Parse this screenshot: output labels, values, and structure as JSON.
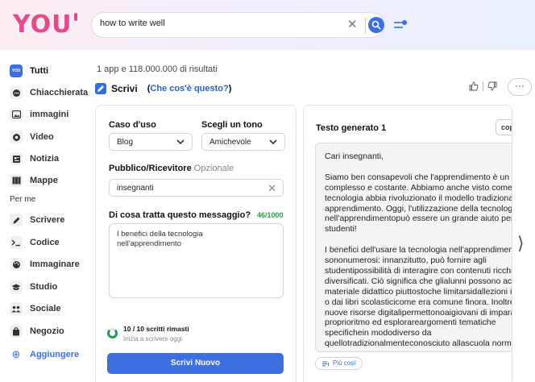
{
  "header": {
    "logo_text": "YOU",
    "search": {
      "value": "how to write well",
      "clear_glyph": "✕"
    }
  },
  "sidebar": {
    "items": [
      {
        "label": "Tutti",
        "icon": "you-logo-icon"
      },
      {
        "label": "Chiacchierata",
        "icon": "chat-icon"
      },
      {
        "label": "immagini",
        "icon": "image-icon"
      },
      {
        "label": "Video",
        "icon": "video-icon"
      },
      {
        "label": "Notizia",
        "icon": "news-icon"
      },
      {
        "label": "Mappe",
        "icon": "map-icon"
      }
    ],
    "section_label": "Per me",
    "personal": [
      {
        "label": "Scrivere",
        "icon": "pencil-icon"
      },
      {
        "label": "Codice",
        "icon": "code-icon"
      },
      {
        "label": "Immaginare",
        "icon": "palette-icon"
      },
      {
        "label": "Studio",
        "icon": "graduation-icon"
      },
      {
        "label": "Sociale",
        "icon": "people-icon"
      },
      {
        "label": "Negozio",
        "icon": "bag-icon"
      }
    ],
    "add_label": "Aggiungere",
    "add_glyph": "⊕",
    "you_badge": "YOU"
  },
  "main": {
    "results_count": "1 app e 118.000.000 di risultati",
    "app_name": "Scrivi",
    "help_open": "(",
    "help_link": "Che cos'è questo?",
    "help_close": ")",
    "more_glyph": "···"
  },
  "form": {
    "use_case_label": "Caso d'uso",
    "use_case_value": "Blog",
    "tone_label": "Scegli un tono",
    "tone_value": "Amichevole",
    "audience_label": "Pubblico/Ricevitore",
    "audience_optional": "Opzionale",
    "audience_value": "insegnanti",
    "clear_glyph": "✕",
    "message_label": "Di cosa tratta questo messaggio?",
    "message_counter": "46/1000",
    "message_value": "I benefici della tecnologia\nnell'apprendimento",
    "quota_text": "10 / 10 scritti rimasti",
    "quota_subtext": "Inizia a scrivere oggi",
    "quota_fraction": 1.0,
    "submit_label": "Scrivi Nuovo"
  },
  "output": {
    "title": "Testo generato 1",
    "copy_label": "cop",
    "lines": [
      "Cari insegnanti,",
      "",
      "Siamo ben consapevoli che l'apprendimento è un processo",
      "complesso e costante. Abbiamo anche visto come la",
      "tecnologia abbia rivoluzionato il modello tradizionale di",
      "apprendimento. Oggi, l'utilizzazione della tecnologia",
      "nell'apprendimentopuò essere un grande aiuto per gli",
      "studenti!",
      "",
      "I benefici dell'usare la tecnologia nell'apprendimento",
      "sononumerosi: innanzitutto, può fornire agli",
      "studentipossibilità di interagire con contenuti ricchi e",
      "diversificati. Ciò significa che glialunni possono accedere a",
      "materiale didattico piuttostoche limitarsidallezioni in classe",
      "o dai libri scolasticicome era comune finora. Inoltre, le",
      "nuove risorse digitalipermettonoaigiovani di imparare al",
      "proprioritmo ed esplorareargomenti tematiche",
      "specifichein mododiverso da",
      "quellotradizionalmenteconosciuto allascuola normale."
    ],
    "more_label": "Più così",
    "nav_glyph": "⟩"
  }
}
